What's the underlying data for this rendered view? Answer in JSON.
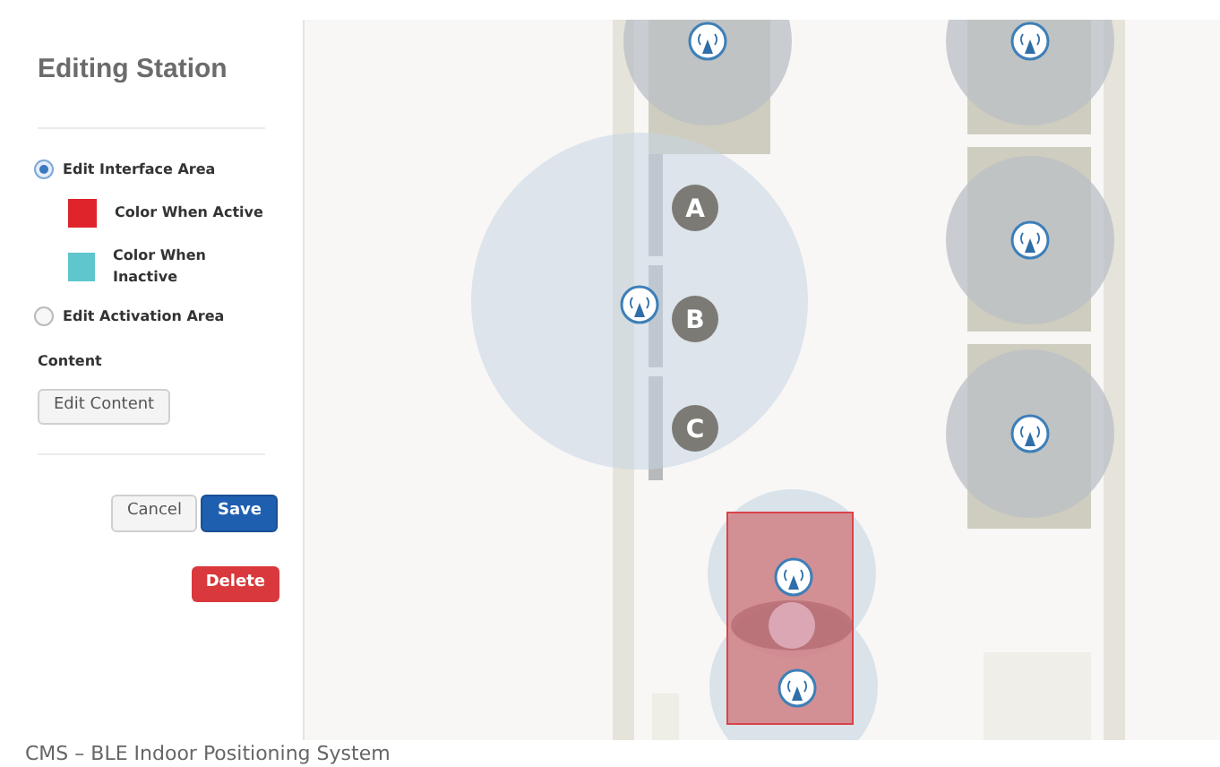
{
  "sidebar": {
    "title": "Editing Station",
    "options": [
      {
        "label": "Edit Interface Area",
        "selected": true,
        "swatches": [
          {
            "label": "Color When Active",
            "color": "#e0242b"
          },
          {
            "label": "Color When Inactive",
            "color": "#5ec6cc"
          }
        ]
      },
      {
        "label": "Edit Activation Area",
        "selected": false
      }
    ],
    "content_heading": "Content",
    "edit_content_button": "Edit Content",
    "buttons": [
      {
        "label": "Cancel",
        "kind": "default"
      },
      {
        "label": "Save",
        "kind": "primary"
      }
    ],
    "delete_button": "Delete"
  },
  "map": {
    "markers": [
      {
        "label": "A"
      },
      {
        "label": "B"
      },
      {
        "label": "C"
      }
    ]
  },
  "caption": "CMS – BLE Indoor Positioning System"
}
